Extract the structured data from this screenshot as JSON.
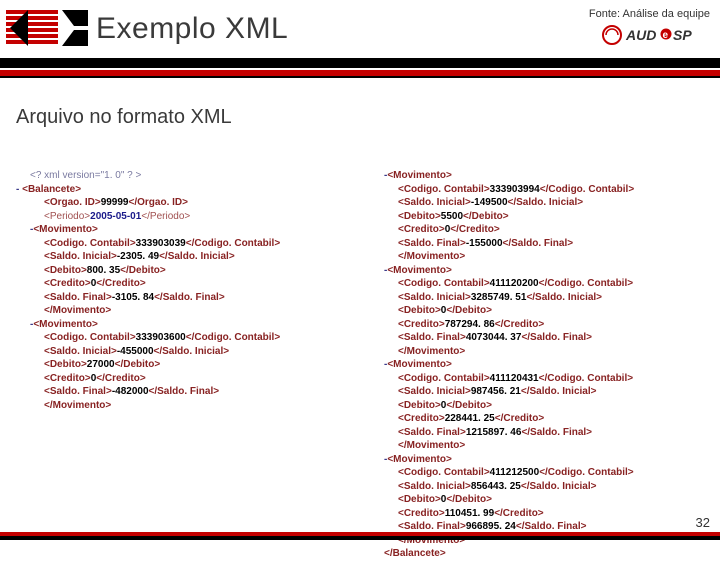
{
  "header": {
    "title": "Exemplo XML",
    "source_label": "Fonte: Análise da equipe"
  },
  "subtitle": "Arquivo no formato XML",
  "xml_declaration": "<? xml version=\"1. 0\" ? >",
  "root_open": "<Balancete>",
  "root_close": "</Balancete>",
  "root_meta": {
    "orgao_open": "<Orgao. ID>",
    "orgao_val": "99999",
    "orgao_close": "</Orgao. ID>",
    "periodo_open": "<Periodo>",
    "periodo_val": "2005-05-01",
    "periodo_close": "</Periodo>"
  },
  "tags": {
    "mov_open": "<Movimento>",
    "mov_close": "</Movimento>",
    "codigo_open": "<Codigo. Contabil>",
    "codigo_close": "</Codigo. Contabil>",
    "saldoi_open": "<Saldo. Inicial>",
    "saldoi_close": "</Saldo. Inicial>",
    "debito_open": "<Debito>",
    "debito_close": "</Debito>",
    "credito_open": "<Credito>",
    "credito_close": "</Credito>",
    "saldof_open": "<Saldo. Final>",
    "saldof_close": "</Saldo. Final>"
  },
  "movs_left": [
    {
      "codigo": "333903039",
      "saldo_inicial": "-2305. 49",
      "debito": "800. 35",
      "credito": "0",
      "saldo_final": "-3105. 84"
    },
    {
      "codigo": "333903600",
      "saldo_inicial": "-455000",
      "debito": "27000",
      "credito": "0",
      "saldo_final": "-482000"
    }
  ],
  "movs_right": [
    {
      "codigo": "333903994",
      "saldo_inicial": "-149500",
      "debito": "5500",
      "credito": "0",
      "saldo_final": "-155000"
    },
    {
      "codigo": "411120200",
      "saldo_inicial": "3285749. 51",
      "debito": "0",
      "credito": "787294. 86",
      "saldo_final": "4073044. 37"
    },
    {
      "codigo": "411120431",
      "saldo_inicial": "987456. 21",
      "debito": "0",
      "credito": "228441. 25",
      "saldo_final": "1215897. 46"
    },
    {
      "codigo": "411212500",
      "saldo_inicial": "856443. 25",
      "debito": "0",
      "credito": "110451. 99",
      "saldo_final": "966895. 24"
    }
  ],
  "page_number": "32"
}
